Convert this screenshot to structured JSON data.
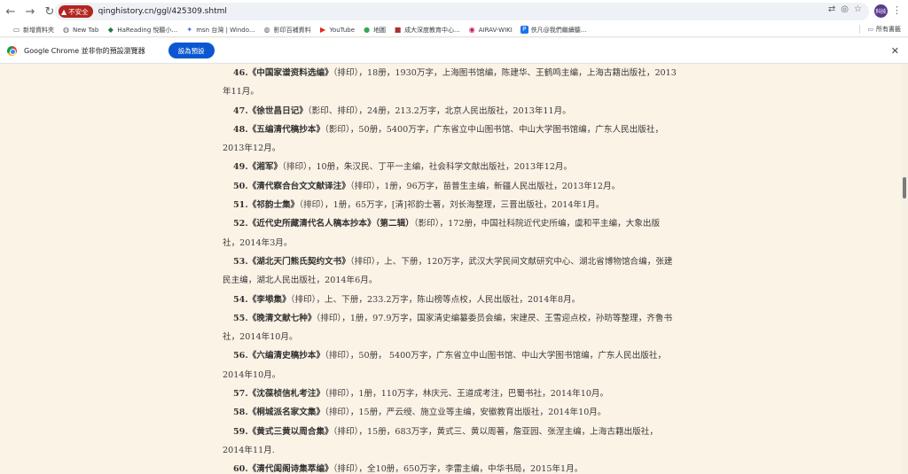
{
  "browser": {
    "insecure_label": "不安全",
    "url": "qinghistory.cn/ggl/425309.shtml",
    "profile_label": "科技"
  },
  "bookmarks": {
    "items": [
      {
        "label": "新增資料夾",
        "icon": "folder-icon"
      },
      {
        "label": "New Tab",
        "icon": "globe-icon"
      },
      {
        "label": "HaReading 悅聽小...",
        "icon": "hareading-icon"
      },
      {
        "label": "msn 台灣 | Windo...",
        "icon": "msn-icon"
      },
      {
        "label": "影印百補資料",
        "icon": "globe-icon"
      },
      {
        "label": "YouTube",
        "icon": "youtube-icon"
      },
      {
        "label": "地圖",
        "icon": "maps-icon"
      },
      {
        "label": "成大深度教育中心...",
        "icon": "ncku-icon"
      },
      {
        "label": "AIRAV-WIKI",
        "icon": "airav-icon"
      },
      {
        "label": "佚凡@我們繼續聽...",
        "icon": "p-icon"
      }
    ],
    "all_bookmarks": "所有書籤"
  },
  "infobar": {
    "message": "Google Chrome 並非你的預設瀏覽器",
    "button": "設為預設"
  },
  "entries": [
    {
      "num": "46.",
      "title": "《中国家谱资料选编》",
      "text": "（排印），18册，1930万字，上海图书馆编，陈建华、王鹤鸣主编，上海古籍出版社，2013年11月。"
    },
    {
      "num": "47.",
      "title": "《徐世昌日记》",
      "text": "（影印、排印），24册，213.2万字，北京人民出版社，2013年11月。"
    },
    {
      "num": "48.",
      "title": "《五编清代稿抄本》",
      "text": "（影印），50册，5400万字，广东省立中山图书馆、中山大学图书馆编，广东人民出版社，2013年12月。"
    },
    {
      "num": "49.",
      "title": "《湘军》",
      "text": "（排印），10册，朱汉民、丁平一主编，社会科学文献出版社，2013年12月。"
    },
    {
      "num": "50.",
      "title": "《清代察合台文文献译注》",
      "text": "（排印），1册，96万字，苗普生主编，新疆人民出版社，2013年12月。"
    },
    {
      "num": "51.",
      "title": "《祁韵士集》",
      "text": "（排印），1册，65万字，[清]祁韵士著，刘长海整理，三晋出版社，2014年1月。"
    },
    {
      "num": "52.",
      "title": "《近代史所藏清代名人稿本抄本》（第二辑）",
      "text": "（影印），172册，中国社科院近代史所编，虞和平主编，大象出版社，2014年3月。"
    },
    {
      "num": "53.",
      "title": "《湖北天门熊氏契约文书》",
      "text": "（排印），上、下册，120万字，武汉大学民间文献研究中心、湖北省博物馆合编，张建民主编，湖北人民出版社，2014年6月。"
    },
    {
      "num": "54.",
      "title": "《李塨集》",
      "text": "（排印），上、下册，233.2万字，陈山榜等点校，人民出版社，2014年8月。"
    },
    {
      "num": "55.",
      "title": "《晚清文献七种》",
      "text": "（排印），1册，97.9万字，国家清史编纂委员会编，宋建昃、王雪迎点校，孙昉等整理，齐鲁书社，2014年10月。"
    },
    {
      "num": "56.",
      "title": "《六编清史稿抄本》",
      "text": "（排印），50册， 5400万字，广东省立中山图书馆、中山大学图书馆编，广东人民出版社，2014年10月。"
    },
    {
      "num": "57.",
      "title": "《沈葆桢信札考注》",
      "text": "（排印），1册，110万字，林庆元、王道成考注，巴蜀书社，2014年10月。"
    },
    {
      "num": "58.",
      "title": "《桐城派名家文集》",
      "text": "（排印），15册，严云绶、施立业等主编，安徽教育出版社，2014年10月。"
    },
    {
      "num": "59.",
      "title": "《黄式三黄以周合集》",
      "text": "（排印），15册，683万字，黄式三、黄以周著，詹亚园、张涅主编，上海古籍出版社，2014年11月."
    },
    {
      "num": "60.",
      "title": "《清代闺阁诗集萃编》",
      "text": "（排印），全10册，650万字，李雷主编，中华书局，2015年1月。"
    }
  ]
}
